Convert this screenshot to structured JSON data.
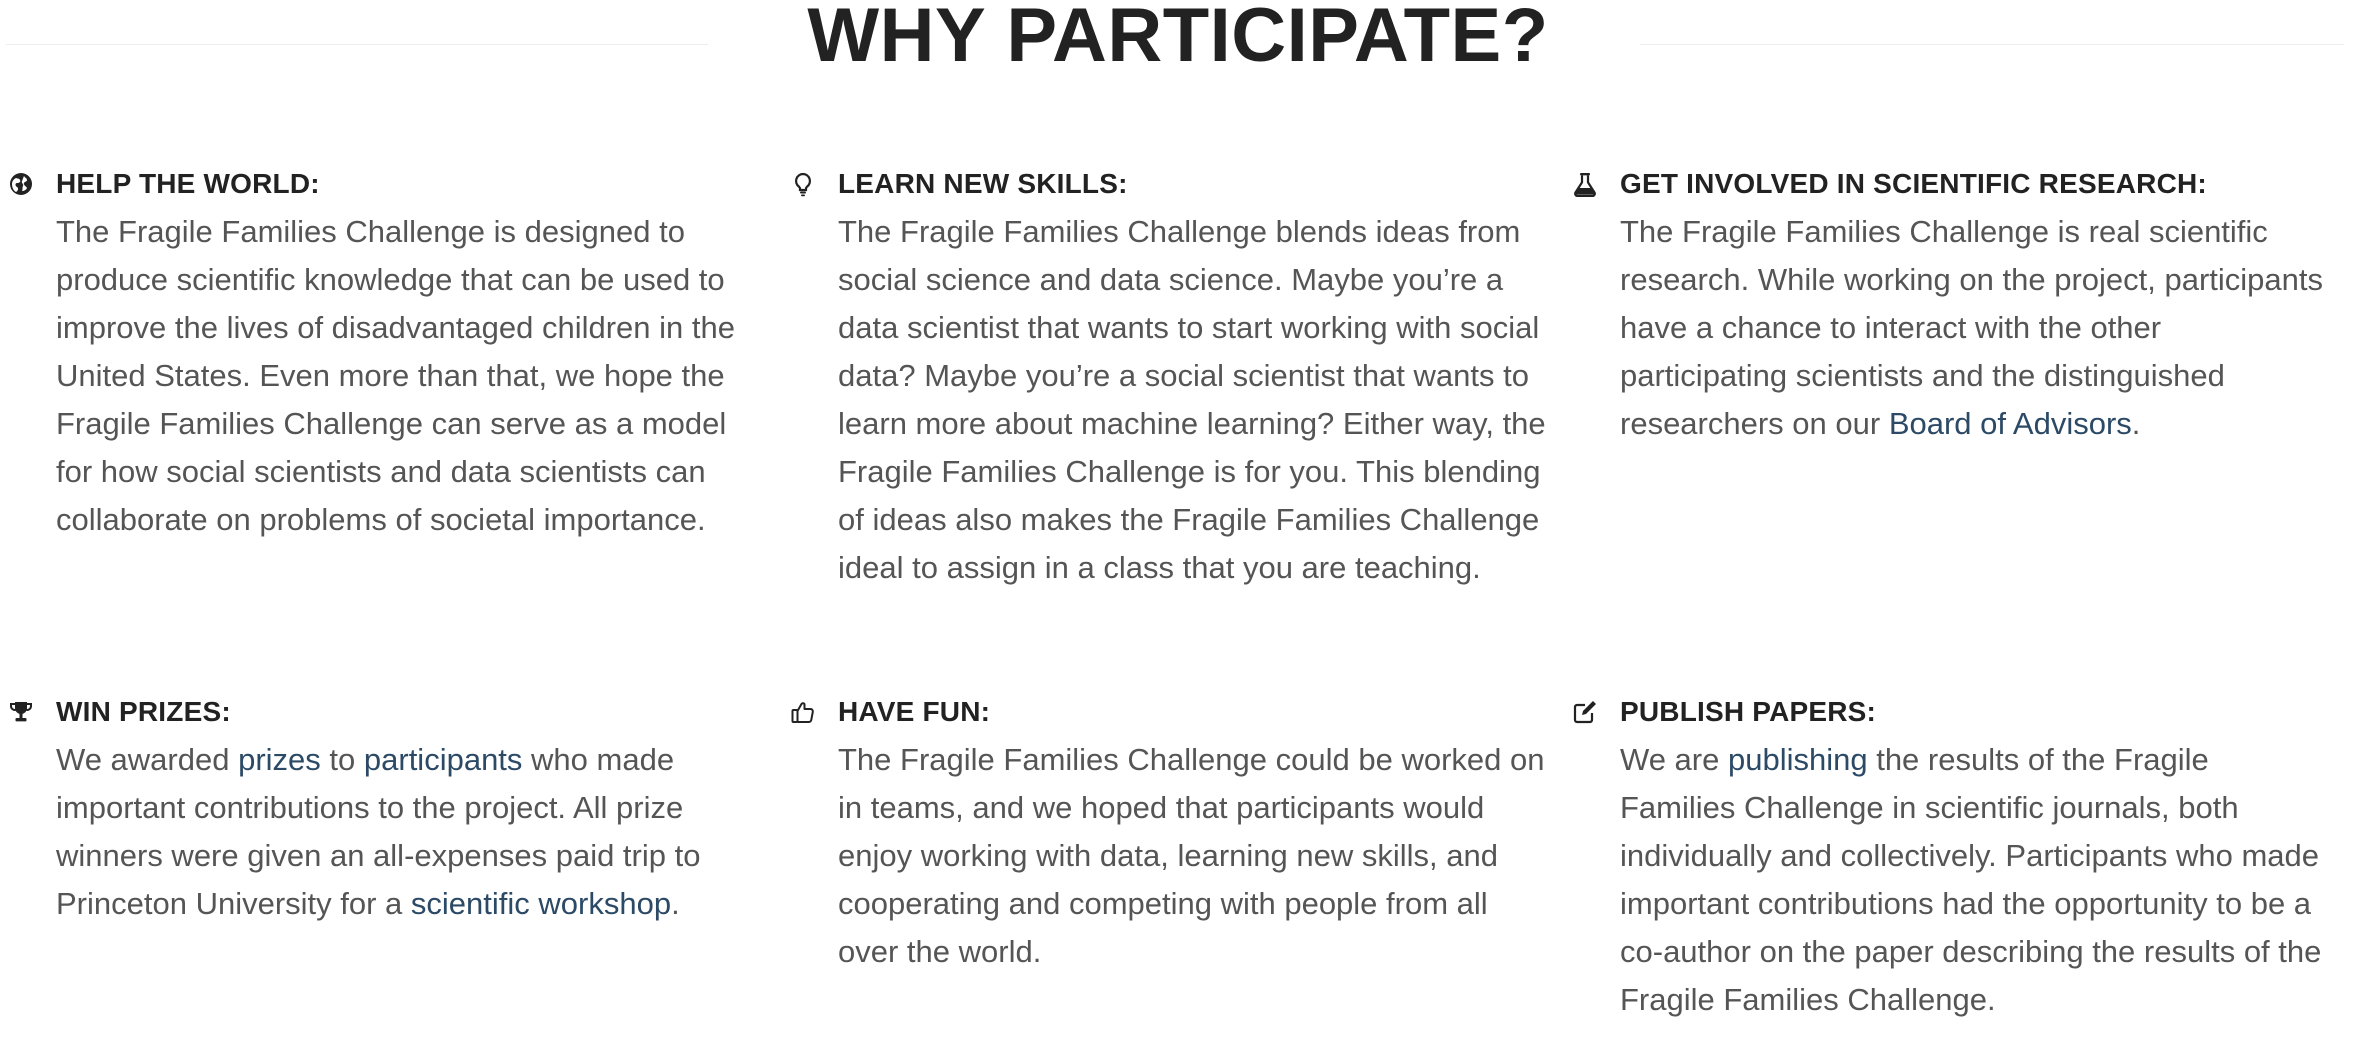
{
  "header": {
    "title": "WHY PARTICIPATE?"
  },
  "cards": [
    {
      "icon": "globe-icon",
      "title": "HELP THE WORLD:",
      "body": "The Fragile Families Challenge is designed to produce scientific knowledge that can be used to improve the lives of disadvantaged children in the United States. Even more than that, we hope the Fragile Families Challenge can serve as a model for how social scientists and data scientists can collaborate on problems of societal importance."
    },
    {
      "icon": "lightbulb-icon",
      "title": "LEARN NEW SKILLS:",
      "body": "The Fragile Families Challenge blends ideas from social science and data science. Maybe you’re a data scientist that wants to start working with social data?  Maybe you’re a social scientist that wants to learn more about machine learning?  Either way, the Fragile Families Challenge is for you. This blending of ideas also makes the Fragile Families Challenge ideal to assign in a class that you are teaching."
    },
    {
      "icon": "flask-icon",
      "title": "GET INVOLVED IN SCIENTIFIC RESEARCH:",
      "body_before": "The Fragile Families Challenge is real scientific research. While working on the project, participants have a chance to interact with the other participating scientists and the distinguished researchers on our ",
      "link": "Board of Advisors",
      "body_after": "."
    },
    {
      "icon": "trophy-icon",
      "title": "WIN PRIZES:",
      "text1": "We awarded ",
      "link1": "prizes",
      "text2": " to ",
      "link2": "participants",
      "text3": " who made important contributions to the project. All prize winners were given an all-expenses paid trip to Princeton University for a ",
      "link3": "scientific workshop",
      "text4": "."
    },
    {
      "icon": "thumbs-up-icon",
      "title": "HAVE FUN:",
      "body": "The Fragile Families Challenge could be worked on in teams, and we hoped that participants would enjoy working with data, learning new skills, and cooperating and competing with people from all over the world."
    },
    {
      "icon": "edit-icon",
      "title": "PUBLISH PAPERS:",
      "text1": "We are ",
      "link1": "publishing",
      "text2": " the results of the Fragile Families Challenge in scientific journals, both individually and collectively. Participants who made important contributions had the opportunity to be a co-author on the paper describing the results of the Fragile Families Challenge."
    }
  ]
}
